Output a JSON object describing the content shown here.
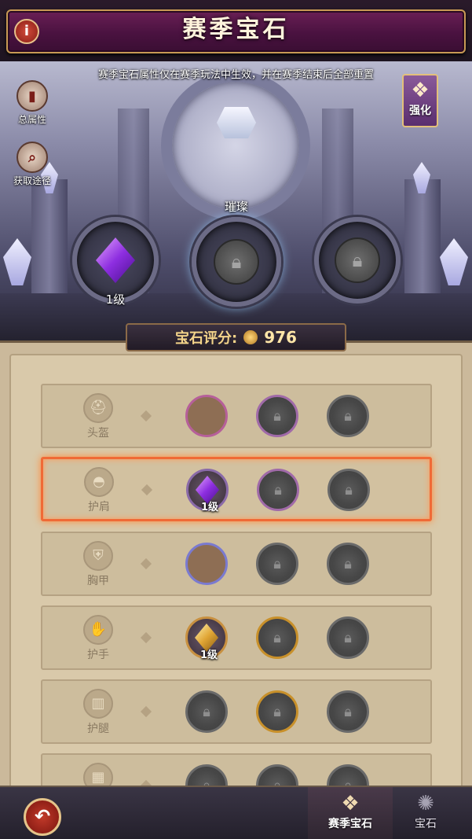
{
  "header": {
    "title": "赛季宝石"
  },
  "scene": {
    "notice": "赛季宝石属性仅在赛季玩法中生效，并在赛季结束后全部重置",
    "side_buttons": [
      {
        "label": "总属性",
        "icon": "attributes-icon"
      },
      {
        "label": "获取途径",
        "icon": "search-icon"
      }
    ],
    "strengthen_label": "强化",
    "sockets": [
      {
        "label": "1级",
        "state": "gem",
        "gem": "purple"
      },
      {
        "label": "璀璨",
        "state": "locked"
      },
      {
        "label": "",
        "state": "locked"
      }
    ]
  },
  "score": {
    "label": "宝石评分:",
    "value": "976"
  },
  "slots": [
    {
      "name": "头盔",
      "icon": "helmet-icon",
      "selected": false,
      "gems": [
        {
          "state": "empty",
          "ring": "#b65f9a"
        },
        {
          "state": "locked",
          "ring": "#a06aa8"
        },
        {
          "state": "locked",
          "ring": "#6a6a6a"
        }
      ]
    },
    {
      "name": "护肩",
      "icon": "pauldron-icon",
      "selected": true,
      "gems": [
        {
          "state": "gem",
          "gem": "purple",
          "level": "1级",
          "ring": "#8a6aa8"
        },
        {
          "state": "locked",
          "ring": "#a06aa8"
        },
        {
          "state": "locked",
          "ring": "#6a6a6a"
        }
      ]
    },
    {
      "name": "胸甲",
      "icon": "chestplate-icon",
      "selected": false,
      "gems": [
        {
          "state": "empty",
          "ring": "#7a7ad0"
        },
        {
          "state": "locked",
          "ring": "#6a6a6a"
        },
        {
          "state": "locked",
          "ring": "#6a6a6a"
        }
      ]
    },
    {
      "name": "护手",
      "icon": "gauntlet-icon",
      "selected": false,
      "gems": [
        {
          "state": "gem",
          "gem": "gold",
          "level": "1级",
          "ring": "#c89040"
        },
        {
          "state": "locked",
          "ring": "#c8902a"
        },
        {
          "state": "locked",
          "ring": "#6a6a6a"
        }
      ]
    },
    {
      "name": "护腿",
      "icon": "greaves-icon",
      "selected": false,
      "gems": [
        {
          "state": "locked",
          "ring": "#6a6a6a"
        },
        {
          "state": "locked",
          "ring": "#c8902a"
        },
        {
          "state": "locked",
          "ring": "#6a6a6a"
        }
      ]
    },
    {
      "name": "",
      "icon": "boots-icon",
      "selected": false,
      "gems": [
        {
          "state": "locked",
          "ring": "#6a6a6a"
        },
        {
          "state": "locked",
          "ring": "#6a6a6a"
        },
        {
          "state": "locked",
          "ring": "#6a6a6a"
        }
      ]
    }
  ],
  "bottom_nav": {
    "tabs": [
      {
        "label": "赛季宝石",
        "icon": "season-gem-icon",
        "active": true
      },
      {
        "label": "宝石",
        "icon": "gem-icon",
        "active": false
      }
    ]
  }
}
